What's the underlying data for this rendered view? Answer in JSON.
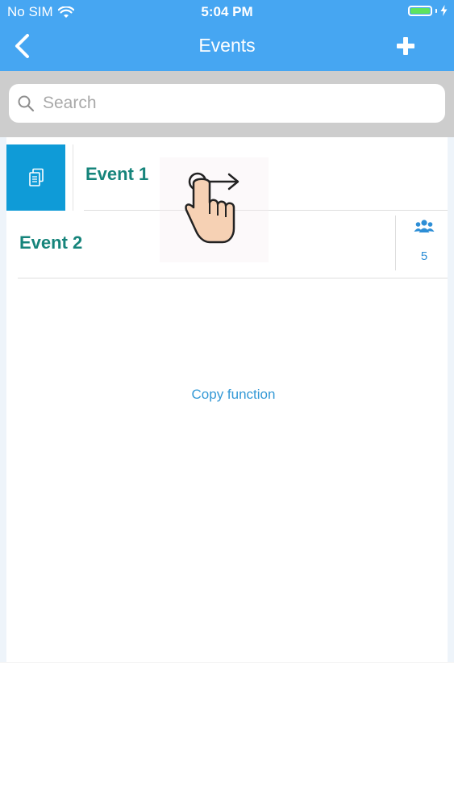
{
  "status_bar": {
    "carrier": "No SIM",
    "time": "5:04 PM",
    "battery_level": 1.0,
    "battery_color": "#5ee35f"
  },
  "nav": {
    "title": "Events",
    "back_icon": "chevron-left-icon",
    "add_icon": "plus-icon"
  },
  "search": {
    "placeholder": "Search",
    "value": ""
  },
  "events": [
    {
      "title": "Event 1",
      "swipe_action_icon": "copy-icon"
    },
    {
      "title": "Event 2",
      "member_count": "5",
      "member_icon": "group-icon"
    }
  ],
  "hint": {
    "label": "Copy function"
  },
  "gesture": {
    "icon": "swipe-right-gesture-icon"
  },
  "colors": {
    "header": "#46a6f2",
    "search_band": "#cdcdcd",
    "accent_teal": "#16847b",
    "copy_action": "#0f9bd7",
    "link_blue": "#3499d6"
  }
}
